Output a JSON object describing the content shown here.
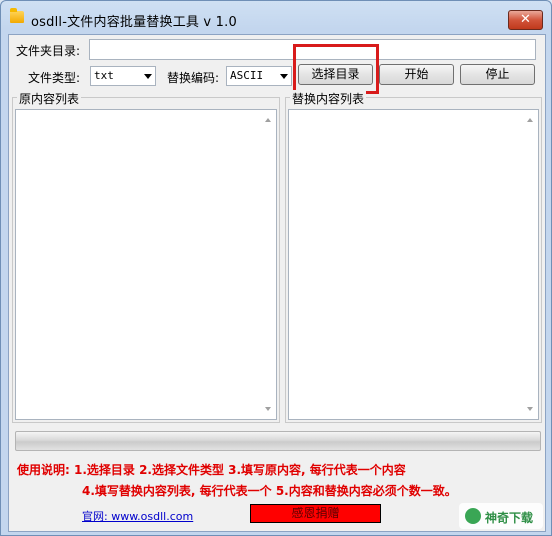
{
  "window": {
    "title": "osdll-文件内容批量替换工具 v 1.0",
    "close_label": "✕"
  },
  "folder": {
    "label": "文件夹目录:",
    "value": ""
  },
  "file_type": {
    "label": "文件类型:",
    "selected": "txt"
  },
  "encoding": {
    "label": "替换编码:",
    "selected": "ASCII"
  },
  "buttons": {
    "select_dir": "选择目录",
    "start": "开始",
    "stop": "停止"
  },
  "lists": {
    "original_title": "原内容列表",
    "replace_title": "替换内容列表"
  },
  "progress": {
    "value": 0
  },
  "instructions": {
    "line1": "使用说明: 1.选择目录   2.选择文件类型   3.填写原内容, 每行代表一个内容",
    "line2": "4.填写替换内容列表, 每行代表一个   5.内容和替换内容必须个数一致。"
  },
  "footer": {
    "website": "官网: www.osdll.com",
    "thanks": "感恩捐赠",
    "watermark": "神奇下载"
  },
  "colors": {
    "instruction_text": "#e00000",
    "thanks_bg": "#ff0000",
    "highlight": "#d81b1b"
  }
}
